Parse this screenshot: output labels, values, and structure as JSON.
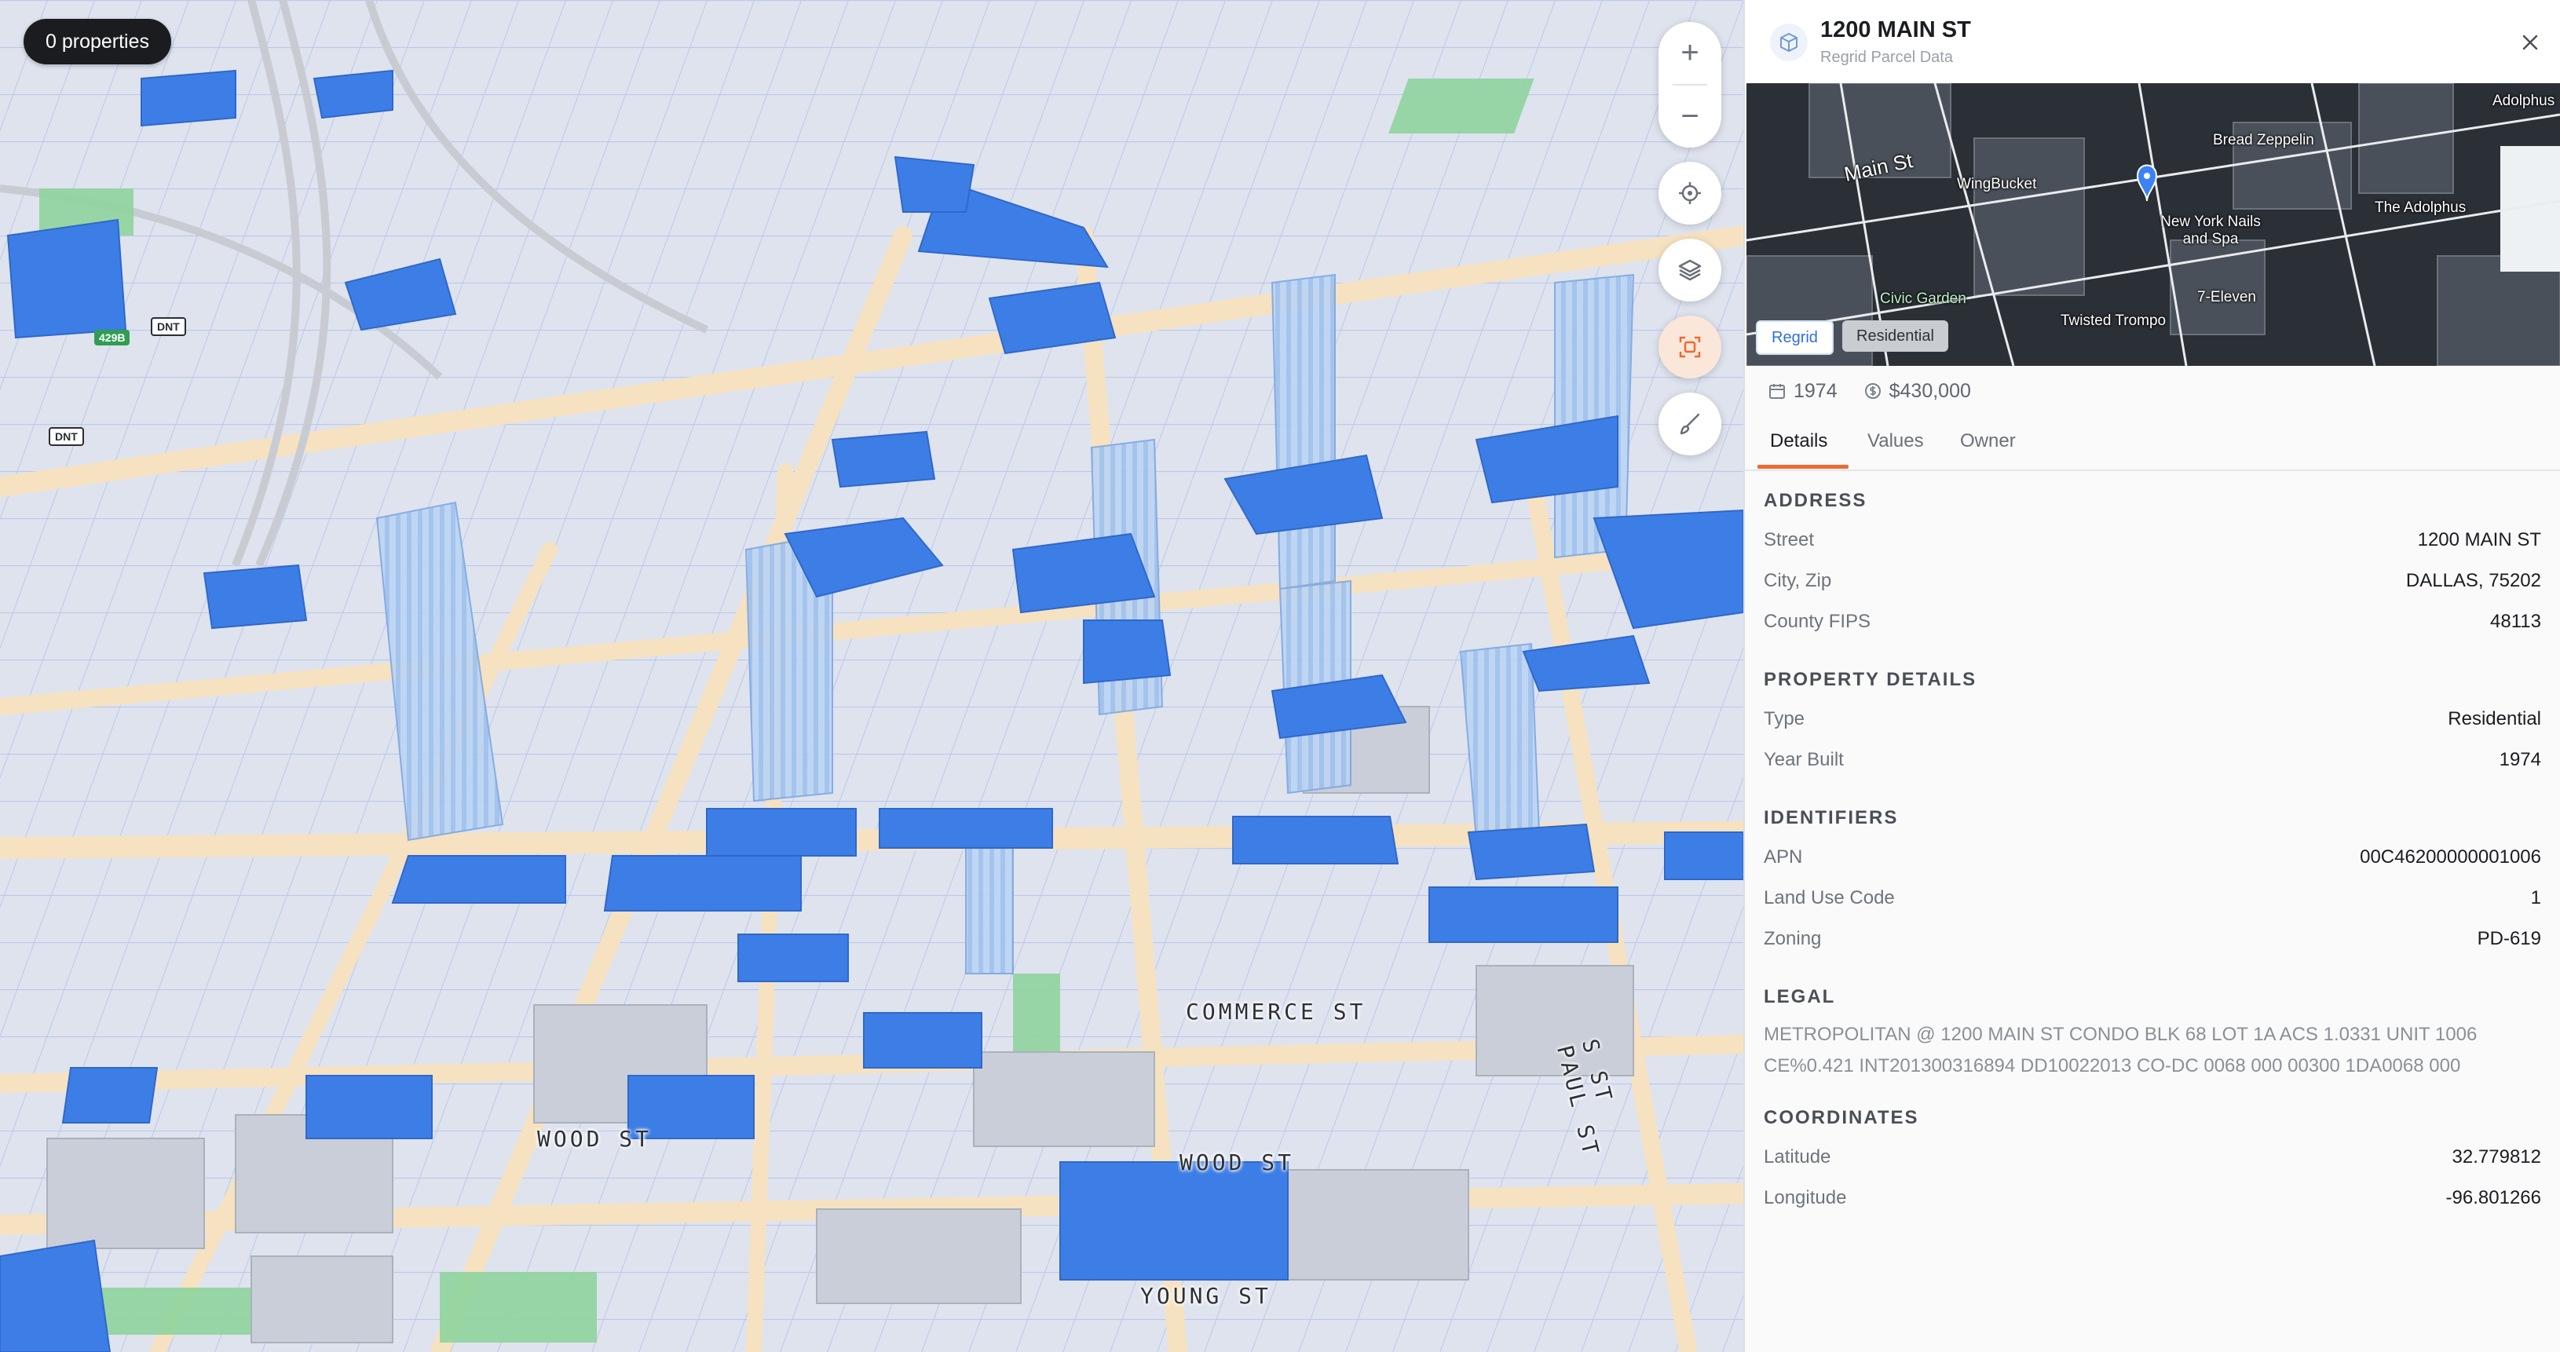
{
  "map": {
    "properties_pill": "0 properties",
    "zoom_in": "+",
    "zoom_out": "−",
    "street_labels": {
      "commerce": "COMMERCE ST",
      "wood_left": "WOOD ST",
      "wood_right": "WOOD ST",
      "young": "YOUNG ST",
      "paul": "S ST PAUL ST"
    },
    "shields": {
      "s429b": "429B",
      "dnt1": "DNT",
      "dnt2": "DNT"
    },
    "colors": {
      "parcel": "#3d7ee6",
      "building": "#c9ced8",
      "road": "#f6e2c0",
      "green": "#8fd49d"
    }
  },
  "panel": {
    "title": "1200 MAIN ST",
    "subtitle": "Regrid Parcel Data",
    "satellite": {
      "street": "Main St",
      "pois": [
        "WingBucket",
        "Bread Zeppelin",
        "Adolphus",
        "The Adolphus",
        "New York Nails and Spa",
        "Civic Garden",
        "7-Eleven",
        "Twisted Trompo"
      ],
      "tag_regrid": "Regrid",
      "tag_type": "Residential"
    },
    "meta": {
      "year": "1974",
      "value": "$430,000"
    },
    "tabs": [
      "Details",
      "Values",
      "Owner"
    ],
    "sections": {
      "address": {
        "heading": "ADDRESS",
        "rows": [
          {
            "label": "Street",
            "value": "1200 MAIN ST"
          },
          {
            "label": "City, Zip",
            "value": "DALLAS, 75202"
          },
          {
            "label": "County FIPS",
            "value": "48113"
          }
        ]
      },
      "property": {
        "heading": "PROPERTY DETAILS",
        "rows": [
          {
            "label": "Type",
            "value": "Residential"
          },
          {
            "label": "Year Built",
            "value": "1974"
          }
        ]
      },
      "identifiers": {
        "heading": "IDENTIFIERS",
        "rows": [
          {
            "label": "APN",
            "value": "00C46200000001006"
          },
          {
            "label": "Land Use Code",
            "value": "1"
          },
          {
            "label": "Zoning",
            "value": "PD-619"
          }
        ]
      },
      "legal": {
        "heading": "LEGAL",
        "text": "METROPOLITAN @ 1200 MAIN ST CONDO BLK 68 LOT 1A ACS 1.0331 UNIT 1006 CE%0.421 INT201300316894 DD10022013 CO-DC 0068 000 00300 1DA0068 000"
      },
      "coordinates": {
        "heading": "COORDINATES",
        "rows": [
          {
            "label": "Latitude",
            "value": "32.779812"
          },
          {
            "label": "Longitude",
            "value": "-96.801266"
          }
        ]
      }
    }
  }
}
